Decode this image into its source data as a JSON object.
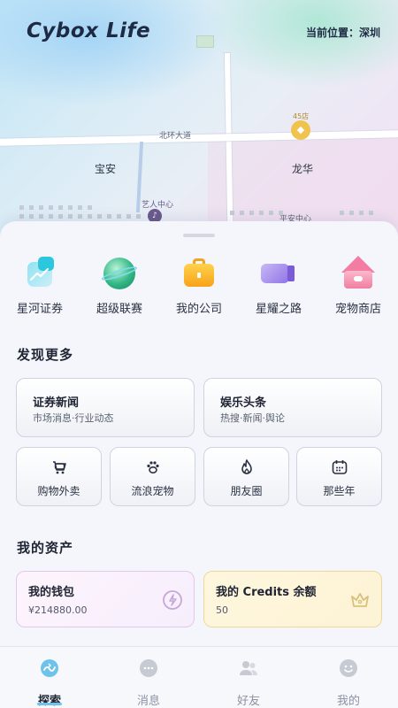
{
  "header": {
    "app_title": "Cybox Life",
    "location_label": "当前位置：深圳"
  },
  "map": {
    "road_label": "北环大道",
    "district_left": "宝安",
    "district_right": "龙华",
    "poi_label_1": "45店",
    "poi_label_2": "艺人中心",
    "poi_label_3": "平安中心"
  },
  "apps": [
    {
      "label": "星河证券",
      "icon": "stock-chart-icon"
    },
    {
      "label": "超级联赛",
      "icon": "planet-icon"
    },
    {
      "label": "我的公司",
      "icon": "briefcase-icon"
    },
    {
      "label": "星耀之路",
      "icon": "video-camera-icon"
    },
    {
      "label": "宠物商店",
      "icon": "pet-house-icon"
    }
  ],
  "discover": {
    "title": "发现更多",
    "cards": [
      {
        "title": "证券新闻",
        "subtitle": "市场消息·行业动态"
      },
      {
        "title": "娱乐头条",
        "subtitle": "热搜·新闻·舆论"
      }
    ],
    "tiles": [
      {
        "label": "购物外卖",
        "icon": "shopping-cart-icon"
      },
      {
        "label": "流浪宠物",
        "icon": "paw-icon"
      },
      {
        "label": "朋友圈",
        "icon": "flame-icon"
      },
      {
        "label": "那些年",
        "icon": "calendar-icon"
      }
    ]
  },
  "assets": {
    "title": "我的资产",
    "wallet": {
      "title": "我的钱包",
      "value": "¥214880.00",
      "icon": "coin-icon"
    },
    "credits": {
      "title": "我的 Credits 余额",
      "value": "50",
      "icon": "crown-icon"
    }
  },
  "tabbar": {
    "active": "探索",
    "items": [
      {
        "label": "探索",
        "icon": "explore-icon"
      },
      {
        "label": "消息",
        "icon": "message-icon"
      },
      {
        "label": "好友",
        "icon": "friends-icon"
      },
      {
        "label": "我的",
        "icon": "profile-icon"
      }
    ]
  },
  "colors": {
    "accent": "#6fc3ea",
    "wallet_bg": "#fbf1fb",
    "credits_bg": "#fdf6df"
  }
}
